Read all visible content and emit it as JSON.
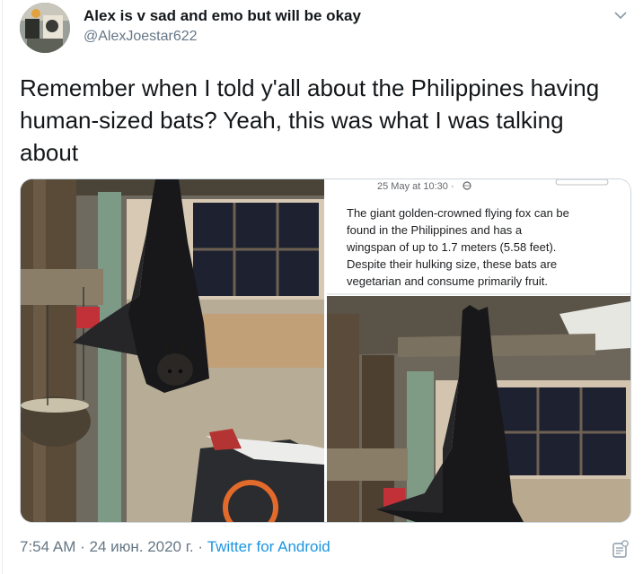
{
  "user": {
    "display_name": "Alex is v sad and emo but will be okay",
    "handle": "@AlexJoestar622"
  },
  "tweet": {
    "text_lines": [
      "Remember when I told y'all about the Philippines having",
      "human-sized bats? Yeah, this was what I was talking",
      "about"
    ]
  },
  "media": {
    "embedded_post": {
      "date": "25 May at 10:30 ·",
      "caption_lines": [
        "The giant golden-crowned flying fox can be",
        "found in the Philippines and has a",
        "wingspan of up to 1.7 meters (5.58 feet).",
        "Despite their hulking size, these bats are",
        "vegetarian and consume primarily fruit."
      ]
    }
  },
  "meta": {
    "time": "7:54 AM",
    "separator1": " · ",
    "date": "24 июн. 2020 г.",
    "separator2": " · ",
    "source": "Twitter for Android"
  },
  "icons": {
    "menu": "chevron-down-icon",
    "globe": "globe-icon",
    "analytics": "analytics-icon"
  },
  "colors": {
    "link": "#1b95e0",
    "secondary_text": "#657786",
    "primary_text": "#14171a",
    "border": "#ccd6dd"
  }
}
